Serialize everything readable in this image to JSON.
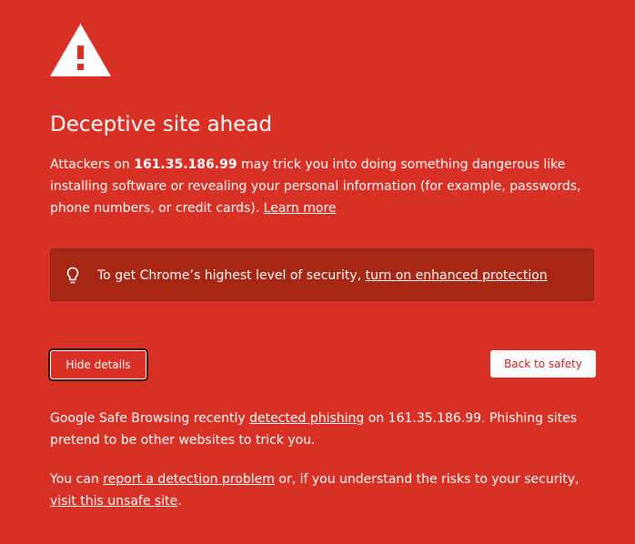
{
  "page": {
    "title": "Deceptive site ahead",
    "icon": "warning-triangle-icon",
    "accent_color": "#d93025"
  },
  "main_message": {
    "part1": "Attackers on ",
    "site": "161.35.186.99",
    "part2": " may trick you into doing something dangerous like installing software or revealing your personal information (for example, passwords, phone numbers, or credit cards). ",
    "learn_more": "Learn more"
  },
  "promo": {
    "icon": "lightbulb-icon",
    "text": "To get Chrome’s highest level of security, ",
    "link": "turn on enhanced protection"
  },
  "buttons": {
    "hide_details": "Hide details",
    "back_to_safety": "Back to safety"
  },
  "details": {
    "p1_part1": "Google Safe Browsing recently ",
    "p1_link": "detected phishing",
    "p1_part2": " on 161.35.186.99. Phishing sites pretend to be other websites to trick you.",
    "p2_part1": "You can ",
    "p2_link1": "report a detection problem",
    "p2_part2": " or, if you understand the risks to your security, ",
    "p2_link2": "visit this unsafe site",
    "p2_part3": "."
  }
}
